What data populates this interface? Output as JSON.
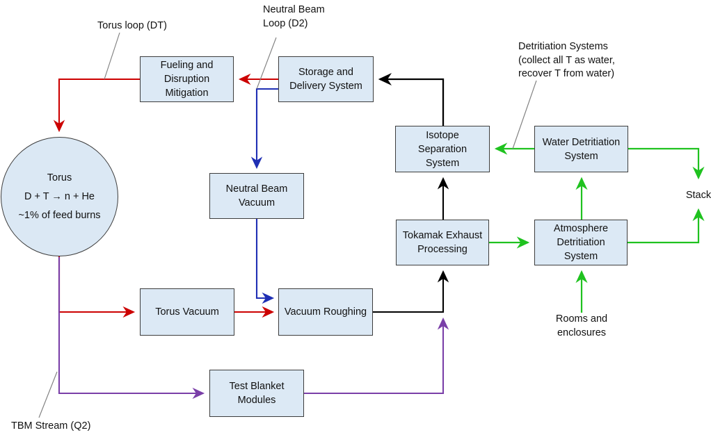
{
  "diagram": {
    "title": "Fusion fuel cycle / tritium plant block diagram",
    "colors": {
      "torus_loop_dt": "#cc0000",
      "neutral_beam_loop_d2": "#1f2fb4",
      "tbm_stream_q2": "#7a3fa8",
      "detritiation_green": "#1fc21f",
      "process_black": "#000000",
      "node_fill": "#dce9f5",
      "node_stroke": "#3c3c3c",
      "leader_line": "#707070"
    },
    "nodes": [
      {
        "id": "torus",
        "shape": "circle",
        "lines": [
          "Torus",
          "D + T → n + He",
          "~1% of feed burns"
        ]
      },
      {
        "id": "fueling",
        "shape": "rect",
        "lines": [
          "Fueling and",
          "Disruption",
          "Mitigation"
        ]
      },
      {
        "id": "storage",
        "shape": "rect",
        "lines": [
          "Storage and",
          "Delivery System"
        ]
      },
      {
        "id": "nbvacuum",
        "shape": "rect",
        "lines": [
          "Neutral Beam",
          "Vacuum"
        ]
      },
      {
        "id": "torusvacuum",
        "shape": "rect",
        "lines": [
          "Torus Vacuum"
        ]
      },
      {
        "id": "vacuumroughing",
        "shape": "rect",
        "lines": [
          "Vacuum Roughing"
        ]
      },
      {
        "id": "testblanket",
        "shape": "rect",
        "lines": [
          "Test Blanket",
          "Modules"
        ]
      },
      {
        "id": "isotope",
        "shape": "rect",
        "lines": [
          "Isotope",
          "Separation",
          "System"
        ]
      },
      {
        "id": "tokamakexhaust",
        "shape": "rect",
        "lines": [
          "Tokamak Exhaust",
          "Processing"
        ]
      },
      {
        "id": "waterdetrit",
        "shape": "rect",
        "lines": [
          "Water Detritiation",
          "System"
        ]
      },
      {
        "id": "atmosdetrit",
        "shape": "rect",
        "lines": [
          "Atmosphere",
          "Detritiation",
          "System"
        ]
      }
    ],
    "annotations": [
      {
        "id": "torus-loop",
        "lines": [
          "Torus loop (DT)"
        ]
      },
      {
        "id": "nb-loop",
        "lines": [
          "Neutral Beam",
          "Loop (D2)"
        ]
      },
      {
        "id": "detrit-systems",
        "lines": [
          "Detritiation Systems",
          "(collect all T as water,",
          "recover T from water)"
        ]
      },
      {
        "id": "tbm-stream",
        "lines": [
          "TBM Stream (Q2)"
        ]
      },
      {
        "id": "stack",
        "lines": [
          "Stack"
        ]
      },
      {
        "id": "rooms",
        "lines": [
          "Rooms and",
          "enclosures"
        ]
      }
    ],
    "flows": [
      {
        "from": "storage",
        "to": "fueling",
        "stream": "Torus loop (DT)"
      },
      {
        "from": "fueling",
        "to": "torus",
        "stream": "Torus loop (DT)"
      },
      {
        "from": "torus",
        "to": "torusvacuum",
        "stream": "Torus loop (DT)"
      },
      {
        "from": "torusvacuum",
        "to": "vacuumroughing",
        "stream": "Torus loop (DT)"
      },
      {
        "from": "storage",
        "to": "nbvacuum",
        "stream": "Neutral Beam Loop (D2)"
      },
      {
        "from": "nbvacuum",
        "to": "vacuumroughing",
        "stream": "Neutral Beam Loop (D2)"
      },
      {
        "from": "torus",
        "to": "testblanket",
        "stream": "TBM Stream (Q2)"
      },
      {
        "from": "testblanket",
        "to": "tokamakexhaust",
        "stream": "TBM Stream (Q2)"
      },
      {
        "from": "vacuumroughing",
        "to": "tokamakexhaust",
        "stream": "process"
      },
      {
        "from": "tokamakexhaust",
        "to": "isotope",
        "stream": "process"
      },
      {
        "from": "isotope",
        "to": "storage",
        "stream": "process"
      },
      {
        "from": "tokamakexhaust",
        "to": "atmosdetrit",
        "stream": "detritiation"
      },
      {
        "from": "rooms",
        "to": "atmosdetrit",
        "stream": "detritiation"
      },
      {
        "from": "atmosdetrit",
        "to": "waterdetrit",
        "stream": "detritiation"
      },
      {
        "from": "waterdetrit",
        "to": "isotope",
        "stream": "detritiation"
      },
      {
        "from": "waterdetrit",
        "to": "stack",
        "stream": "detritiation"
      },
      {
        "from": "atmosdetrit",
        "to": "stack",
        "stream": "detritiation"
      }
    ]
  }
}
